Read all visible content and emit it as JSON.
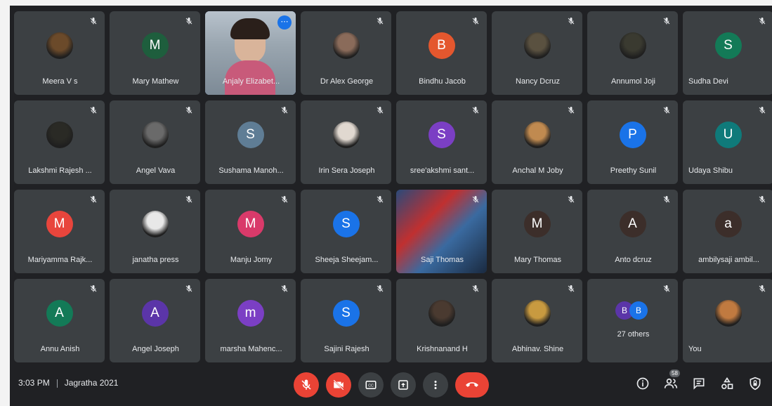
{
  "participants": [
    {
      "name": "Meera V s",
      "kind": "photo",
      "color": "#6b4a2a"
    },
    {
      "name": "Mary Mathew",
      "kind": "letter",
      "letter": "M",
      "color": "#1e5e3d"
    },
    {
      "name": "Anjaly Elizabet...",
      "kind": "video",
      "color": "#8a8f9a"
    },
    {
      "name": "Dr Alex George",
      "kind": "photo",
      "color": "#8a6b5a"
    },
    {
      "name": "Bindhu Jacob",
      "kind": "letter",
      "letter": "B",
      "color": "#e4572e"
    },
    {
      "name": "Nancy Dcruz",
      "kind": "photo",
      "color": "#5a5140"
    },
    {
      "name": "Annumol Joji",
      "kind": "photo",
      "color": "#3a3a30"
    },
    {
      "name": "Sudha Devi",
      "kind": "letter",
      "letter": "S",
      "color": "#137a57"
    },
    {
      "name": "Lakshmi Rajesh ...",
      "kind": "photo",
      "color": "#2a2a25"
    },
    {
      "name": "Angel Vava",
      "kind": "photo",
      "color": "#6a6a6a"
    },
    {
      "name": "Sushama Manoh...",
      "kind": "letter",
      "letter": "S",
      "color": "#5f7d95"
    },
    {
      "name": "Irin Sera Joseph",
      "kind": "photo",
      "color": "#e0d8d0"
    },
    {
      "name": "sree'akshmi sant...",
      "kind": "letter",
      "letter": "S",
      "color": "#7b3fc4"
    },
    {
      "name": "Anchal M Joby",
      "kind": "photo",
      "color": "#c08a50"
    },
    {
      "name": "Preethy Sunil",
      "kind": "letter",
      "letter": "P",
      "color": "#1a73e8"
    },
    {
      "name": "Udaya Shibu",
      "kind": "letter",
      "letter": "U",
      "color": "#0f7a7a"
    },
    {
      "name": "Mariyamma Rajk...",
      "kind": "letter",
      "letter": "M",
      "color": "#e8453c"
    },
    {
      "name": "janatha press",
      "kind": "photo",
      "color": "#e8e8e8"
    },
    {
      "name": "Manju Jomy",
      "kind": "letter",
      "letter": "M",
      "color": "#d93a6a"
    },
    {
      "name": "Sheeja Sheejam...",
      "kind": "letter",
      "letter": "S",
      "color": "#1a73e8"
    },
    {
      "name": "Saji Thomas",
      "kind": "video",
      "color": "#4a6a8a"
    },
    {
      "name": "Mary Thomas",
      "kind": "letter",
      "letter": "M",
      "color": "#3c2e2a"
    },
    {
      "name": "Anto dcruz",
      "kind": "letter",
      "letter": "A",
      "color": "#3c2e2a"
    },
    {
      "name": "ambilysaji ambil...",
      "kind": "letter",
      "letter": "a",
      "color": "#3c2e2a"
    },
    {
      "name": "Annu Anish",
      "kind": "letter",
      "letter": "A",
      "color": "#137a57"
    },
    {
      "name": "Angel Joseph",
      "kind": "letter",
      "letter": "A",
      "color": "#5b35a8"
    },
    {
      "name": "marsha Mahenc...",
      "kind": "letter",
      "letter": "m",
      "color": "#7b3fc4"
    },
    {
      "name": "Sajini Rajesh",
      "kind": "letter",
      "letter": "S",
      "color": "#1a73e8"
    },
    {
      "name": "Krishnanand H",
      "kind": "photo",
      "color": "#4a3a30"
    },
    {
      "name": "Abhinav. Shine",
      "kind": "photo",
      "color": "#c89a40"
    },
    {
      "name": "27 others",
      "kind": "others",
      "color": "#5b35a8"
    },
    {
      "name": "You",
      "kind": "photo",
      "color": "#c07a40"
    }
  ],
  "bottom": {
    "time": "3:03 PM",
    "meeting_name": "Jagratha 2021",
    "people_count": "58"
  },
  "colors": {
    "background": "#202124",
    "tile": "#3c4043",
    "accent": "#1a73e8",
    "danger": "#ea4335"
  }
}
